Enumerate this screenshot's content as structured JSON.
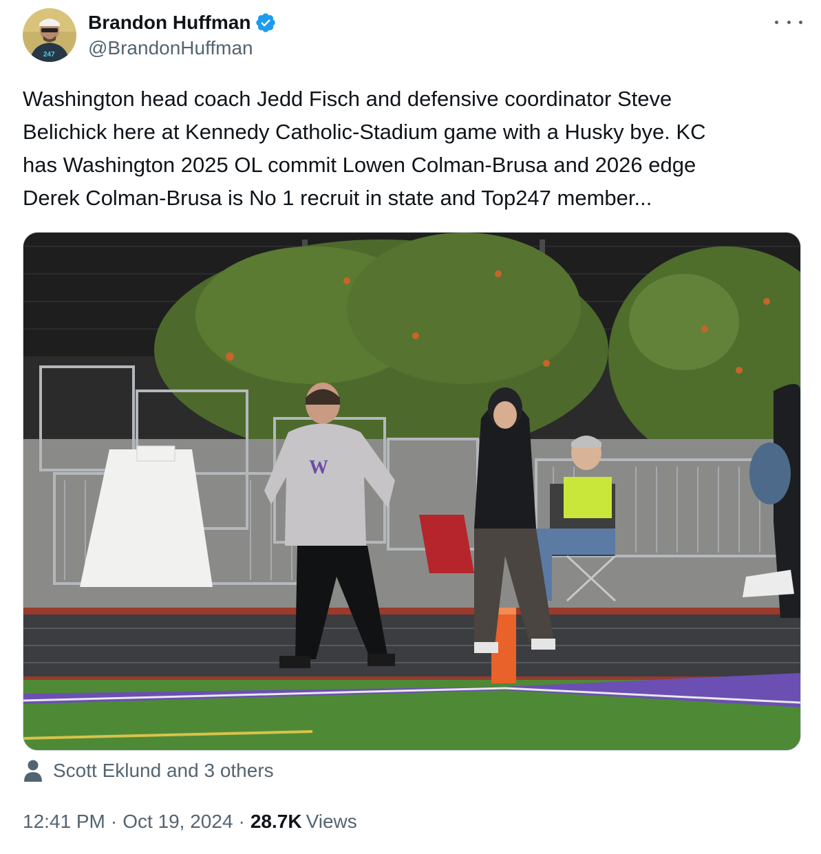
{
  "author": {
    "name": "Brandon Huffman",
    "handle": "@BrandonHuffman",
    "verified": true,
    "avatar_shirt_text": "247"
  },
  "tweet": {
    "text": "Washington head coach Jedd Fisch and defensive coordinator Steve\nBelichick here at Kennedy Catholic-Stadium game with a Husky bye. KC\nhas Washington 2025 OL commit Lowen Colman-Brusa and 2026 edge\nDerek Colman-Brusa is No 1 recruit in state and Top247 member...",
    "time": "12:41 PM",
    "date": "Oct 19, 2024",
    "views_count": "28.7K",
    "views_label": "Views"
  },
  "media": {
    "hoodie_letter": "W"
  },
  "tagged": {
    "text": "Scott Eklund and 3 others"
  },
  "icons": {
    "verified": "verified-badge-icon",
    "more": "more-dots-icon",
    "person": "person-icon"
  },
  "colors": {
    "verified_blue": "#1d9bf0",
    "secondary_text": "#536471",
    "primary_text": "#0f1419"
  }
}
